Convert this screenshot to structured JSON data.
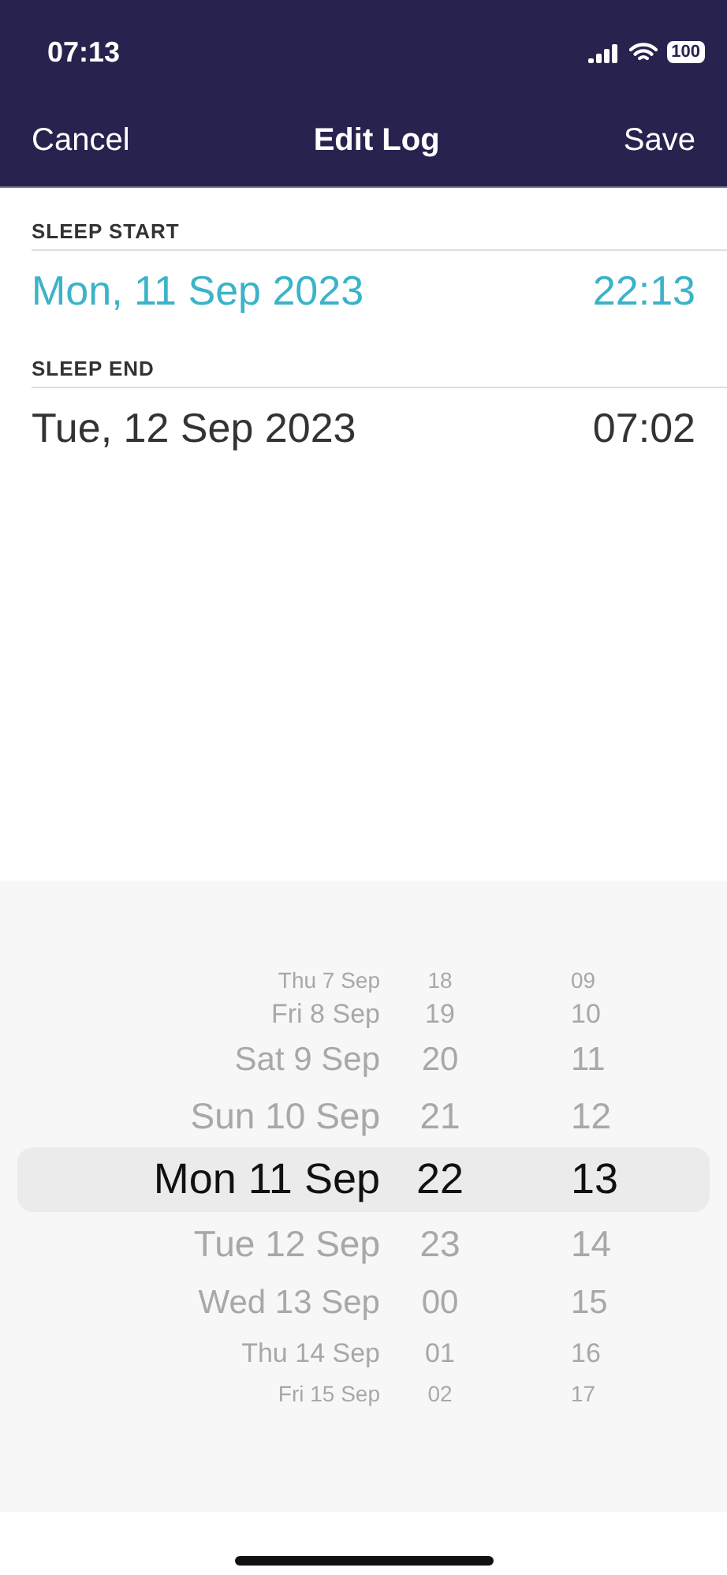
{
  "status_bar": {
    "time": "07:13",
    "battery": "100"
  },
  "nav": {
    "cancel": "Cancel",
    "title": "Edit Log",
    "save": "Save"
  },
  "fields": [
    {
      "label": "SLEEP START",
      "date": "Mon, 11 Sep 2023",
      "time": "22:13",
      "selected": true
    },
    {
      "label": "SLEEP END",
      "date": "Tue, 12 Sep 2023",
      "time": "07:02",
      "selected": false
    }
  ],
  "picker": {
    "rows": [
      {
        "date": "Thu 7 Sep",
        "hour": "18",
        "minute": "09",
        "selected": false
      },
      {
        "date": "Fri 8 Sep",
        "hour": "19",
        "minute": "10",
        "selected": false
      },
      {
        "date": "Sat 9 Sep",
        "hour": "20",
        "minute": "11",
        "selected": false
      },
      {
        "date": "Sun 10 Sep",
        "hour": "21",
        "minute": "12",
        "selected": false
      },
      {
        "date": "Mon 11 Sep",
        "hour": "22",
        "minute": "13",
        "selected": true
      },
      {
        "date": "Tue 12 Sep",
        "hour": "23",
        "minute": "14",
        "selected": false
      },
      {
        "date": "Wed 13 Sep",
        "hour": "00",
        "minute": "15",
        "selected": false
      },
      {
        "date": "Thu 14 Sep",
        "hour": "01",
        "minute": "16",
        "selected": false
      },
      {
        "date": "Fri 15 Sep",
        "hour": "02",
        "minute": "17",
        "selected": false
      }
    ]
  }
}
